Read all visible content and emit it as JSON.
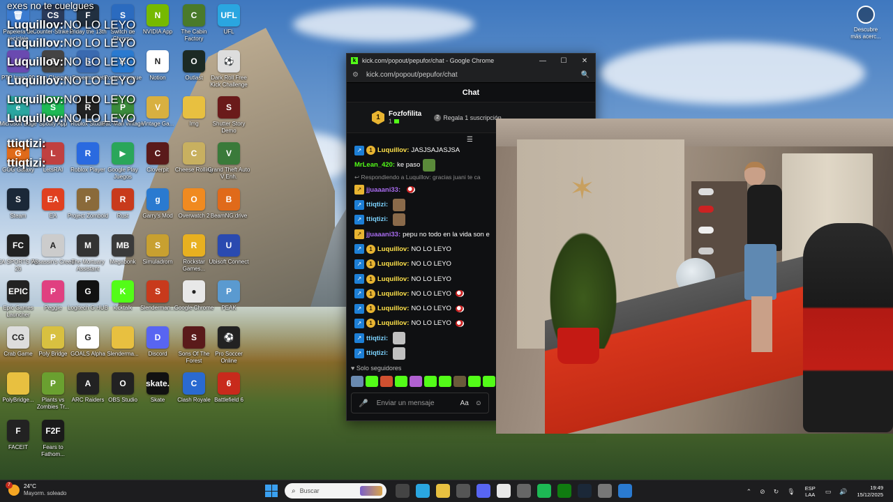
{
  "overlay": {
    "top_text": "exes no te cuelgues",
    "lines": [
      {
        "user": "Luquillov:",
        "text": "NO LO LEYO"
      },
      {
        "user": "Luquillov:",
        "text": "NO LO LEYO"
      },
      {
        "user": "Luquillov:",
        "text": "NO LO LEYO"
      },
      {
        "user": "Luquillov:",
        "text": "NO LO LEYO"
      },
      {
        "user": "Luquillov:",
        "text": "NO LO LEYO"
      },
      {
        "user": "Luquillov:",
        "text": "NO LO LEYO"
      },
      {
        "user": "ttiqtizi:",
        "text": ""
      },
      {
        "user": "ttiqtizi:",
        "text": ""
      }
    ]
  },
  "desktop_icons": [
    {
      "label": "Papelera de reciclaje",
      "color": "#3b7bd0",
      "glyph": "🗑"
    },
    {
      "label": "Counter-Strike 2",
      "color": "#2a3a5a",
      "glyph": "CS"
    },
    {
      "label": "Friday the 13th",
      "color": "#213040",
      "glyph": "F"
    },
    {
      "label": "Switch de Chrome",
      "color": "#2b6bbf",
      "glyph": "S"
    },
    {
      "label": "NVIDIA App",
      "color": "#76b900",
      "glyph": "N"
    },
    {
      "label": "The Cabin Factory",
      "color": "#4a7a2a",
      "glyph": "C"
    },
    {
      "label": "UFL",
      "color": "#2aa6e0",
      "glyph": "UFL"
    },
    {
      "label": "PTP Isaac 90",
      "color": "#6a4ab0",
      "glyph": "V"
    },
    {
      "label": "Tom Clancy's",
      "color": "#444",
      "glyph": "G"
    },
    {
      "label": "Supermarket",
      "color": "#3a6ab0",
      "glyph": "S"
    },
    {
      "label": "Rocket League",
      "color": "#2a7ad0",
      "glyph": "R"
    },
    {
      "label": "Notion",
      "color": "#fff",
      "glyph": "N"
    },
    {
      "label": "Outlast",
      "color": "#1c2a24",
      "glyph": "O"
    },
    {
      "label": "Dark Roll Free Kick Challenge",
      "color": "#ddd",
      "glyph": "⚽"
    },
    {
      "label": "Microsoft Edge",
      "color": "#2aa6a0",
      "glyph": "e"
    },
    {
      "label": "Spotify App",
      "color": "#1db954",
      "glyph": "S"
    },
    {
      "label": "Roblox Studio",
      "color": "#222",
      "glyph": "R"
    },
    {
      "label": "Pac-Man vintage",
      "color": "#3a8a3a",
      "glyph": "P"
    },
    {
      "label": "Vintage Ga...",
      "color": "#d8b040",
      "glyph": "V"
    },
    {
      "label": "Img",
      "color": "#e8c040",
      "glyph": ""
    },
    {
      "label": "Shutter Story Demo",
      "color": "#6a1a1a",
      "glyph": "S"
    },
    {
      "label": "GOG Galaxy",
      "color": "#e06a1a",
      "glyph": "G"
    },
    {
      "label": "LetsRAI",
      "color": "#c04040",
      "glyph": "L"
    },
    {
      "label": "Roblox Player",
      "color": "#2a6ae0",
      "glyph": "R"
    },
    {
      "label": "Google Play Juegos",
      "color": "#2aa65a",
      "glyph": "▶"
    },
    {
      "label": "Cloverpit",
      "color": "#5a1a1a",
      "glyph": "C"
    },
    {
      "label": "Cheese Rolling",
      "color": "#c8b060",
      "glyph": "C"
    },
    {
      "label": "Grand Theft Auto V Enh.",
      "color": "#3a7a3a",
      "glyph": "V"
    },
    {
      "label": "Steam",
      "color": "#1b2838",
      "glyph": "S"
    },
    {
      "label": "EA",
      "color": "#e04020",
      "glyph": "EA"
    },
    {
      "label": "Project Zomboid",
      "color": "#8a6a3a",
      "glyph": "P"
    },
    {
      "label": "Rust",
      "color": "#c83a1c",
      "glyph": "R"
    },
    {
      "label": "Garry's Mod",
      "color": "#2a7ad0",
      "glyph": "g"
    },
    {
      "label": "Overwatch 2",
      "color": "#f08a20",
      "glyph": "O"
    },
    {
      "label": "BeamNG.drive",
      "color": "#e06a1a",
      "glyph": "B"
    },
    {
      "label": "EA SPORTS FC 26",
      "color": "#222",
      "glyph": "FC"
    },
    {
      "label": "Assassin's Creed",
      "color": "#ccc",
      "glyph": "A"
    },
    {
      "label": "The Mortuary Assistant",
      "color": "#333",
      "glyph": "M"
    },
    {
      "label": "Megabonk",
      "color": "#3a3a3a",
      "glyph": "MB"
    },
    {
      "label": "Simuladrorn",
      "color": "#c8a030",
      "glyph": "S"
    },
    {
      "label": "Rockstar Games...",
      "color": "#e8b020",
      "glyph": "R"
    },
    {
      "label": "Ubisoft Connect",
      "color": "#2a4ab0",
      "glyph": "U"
    },
    {
      "label": "Epic Games Launcher",
      "color": "#222",
      "glyph": "EPIC"
    },
    {
      "label": "Peggle",
      "color": "#e04080",
      "glyph": "P"
    },
    {
      "label": "Logitech G HUB",
      "color": "#111",
      "glyph": "G"
    },
    {
      "label": "kicktalk",
      "color": "#53fc18",
      "glyph": "K"
    },
    {
      "label": "Slenderman...",
      "color": "#c83a1c",
      "glyph": "S"
    },
    {
      "label": "Google Chrome",
      "color": "#e8e8e8",
      "glyph": "●"
    },
    {
      "label": "PEAK",
      "color": "#5a9ad0",
      "glyph": "P"
    },
    {
      "label": "Crab Game",
      "color": "#ddd",
      "glyph": "CG"
    },
    {
      "label": "Poly Bridge",
      "color": "#d8c040",
      "glyph": "P"
    },
    {
      "label": "GOALS Alpha",
      "color": "#fff",
      "glyph": "G"
    },
    {
      "label": "Slenderma...",
      "color": "#e8c040",
      "glyph": ""
    },
    {
      "label": "Discord",
      "color": "#5865f2",
      "glyph": "D"
    },
    {
      "label": "Sons Of The Forest",
      "color": "#5a1a1a",
      "glyph": "S"
    },
    {
      "label": "Pro Soccer Online",
      "color": "#222",
      "glyph": "⚽"
    },
    {
      "label": "PolyBridge...",
      "color": "#e8c040",
      "glyph": ""
    },
    {
      "label": "Plants vs Zombies Tr...",
      "color": "#6aa030",
      "glyph": "P"
    },
    {
      "label": "ARC Raiders",
      "color": "#222",
      "glyph": "A"
    },
    {
      "label": "OBS Studio",
      "color": "#222",
      "glyph": "O"
    },
    {
      "label": "Skate",
      "color": "#111",
      "glyph": "skate."
    },
    {
      "label": "Clash Royale",
      "color": "#2a6ad0",
      "glyph": "C"
    },
    {
      "label": "Battlefield 6",
      "color": "#c82a1c",
      "glyph": "6"
    },
    {
      "label": "FACEIT",
      "color": "#222",
      "glyph": "F"
    },
    {
      "label": "Fears to Fathom...",
      "color": "#1a1a1a",
      "glyph": "F2F"
    }
  ],
  "widget": {
    "label": "Descubre más acerc..."
  },
  "chrome": {
    "title": "kick.com/popout/pepufor/chat - Google Chrome",
    "url": "kick.com/popout/pepufor/chat",
    "minimize": "—",
    "maximize": "☐",
    "close": "✕"
  },
  "chat": {
    "header": "Chat",
    "pinned": {
      "badge": "1",
      "name": "Fozfofilita",
      "sub": "1",
      "gift_count": "2",
      "gift_text": "Regala 1 suscripción"
    },
    "reply_text": "↩ Respondiendo a Luquillov: gracias juani te ca",
    "messages": [
      {
        "type": "msg",
        "badge": "blue",
        "coin": "1",
        "user": "Luquillov:",
        "user_color": "#ffe24a",
        "text": "JASJSAJASJSA",
        "emote": ""
      },
      {
        "type": "msg",
        "badge": "",
        "coin": "",
        "user": "MrLean_420:",
        "user_color": "#53fc18",
        "text": "ke paso",
        "emote": "#5a8a3a"
      },
      {
        "type": "reply"
      },
      {
        "type": "msg",
        "badge": "gold",
        "coin": "",
        "user": "jjuaaani33:",
        "user_color": "#a96cf0",
        "text": "",
        "emote": "small"
      },
      {
        "type": "msg",
        "badge": "blue",
        "coin": "",
        "user": "ttiqtizi:",
        "user_color": "#7cd3ff",
        "text": "",
        "emote": "#8a6a4a"
      },
      {
        "type": "msg",
        "badge": "blue",
        "coin": "",
        "user": "ttiqtizi:",
        "user_color": "#7cd3ff",
        "text": "",
        "emote": "#8a6a4a"
      },
      {
        "type": "msg",
        "badge": "gold",
        "coin": "",
        "user": "jjuaaani33:",
        "user_color": "#a96cf0",
        "text": "pepu no todo en la vida son e",
        "emote": ""
      },
      {
        "type": "msg",
        "badge": "blue",
        "coin": "1",
        "user": "Luquillov:",
        "user_color": "#ffe24a",
        "text": "NO LO LEYO",
        "emote": ""
      },
      {
        "type": "msg",
        "badge": "blue",
        "coin": "1",
        "user": "Luquillov:",
        "user_color": "#ffe24a",
        "text": "NO LO LEYO",
        "emote": ""
      },
      {
        "type": "msg",
        "badge": "blue",
        "coin": "1",
        "user": "Luquillov:",
        "user_color": "#ffe24a",
        "text": "NO LO LEYO",
        "emote": ""
      },
      {
        "type": "msg",
        "badge": "blue",
        "coin": "1",
        "user": "Luquillov:",
        "user_color": "#ffe24a",
        "text": "NO LO LEYO",
        "emote": "small"
      },
      {
        "type": "msg",
        "badge": "blue",
        "coin": "1",
        "user": "Luquillov:",
        "user_color": "#ffe24a",
        "text": "NO LO LEYO",
        "emote": "small"
      },
      {
        "type": "msg",
        "badge": "blue",
        "coin": "1",
        "user": "Luquillov:",
        "user_color": "#ffe24a",
        "text": "NO LO LEYO",
        "emote": "small"
      },
      {
        "type": "msg",
        "badge": "blue",
        "coin": "",
        "user": "ttiqtizi:",
        "user_color": "#7cd3ff",
        "text": "",
        "emote": "#c0c0c0"
      },
      {
        "type": "msg",
        "badge": "blue",
        "coin": "",
        "user": "ttiqtizi:",
        "user_color": "#7cd3ff",
        "text": "",
        "emote": "#c0c0c0"
      }
    ],
    "followers_only": "Solo seguidores",
    "input_placeholder": "Enviar un mensaje",
    "emote_colors": [
      "#6a8ab0",
      "#53fc18",
      "#d05030",
      "#53fc18",
      "#b060d0",
      "#53fc18",
      "#53fc18",
      "#6a5a3a",
      "#53fc18",
      "#53fc18"
    ]
  },
  "taskbar": {
    "weather_temp": "24°C",
    "weather_desc": "Mayorm. soleado",
    "weather_badge": "7",
    "search_placeholder": "Buscar",
    "apps": [
      {
        "name": "task-view-icon",
        "color": "#444"
      },
      {
        "name": "edge-icon",
        "color": "#2aa6e0"
      },
      {
        "name": "file-explorer-icon",
        "color": "#e8c040"
      },
      {
        "name": "store-icon",
        "color": "#555"
      },
      {
        "name": "discord-icon",
        "color": "#5865f2"
      },
      {
        "name": "chrome-icon",
        "color": "#e8e8e8"
      },
      {
        "name": "clock-app-icon",
        "color": "#666"
      },
      {
        "name": "spotify-icon",
        "color": "#1db954"
      },
      {
        "name": "xbox-icon",
        "color": "#107c10"
      },
      {
        "name": "steam-icon",
        "color": "#1b2838"
      },
      {
        "name": "settings-icon",
        "color": "#777"
      },
      {
        "name": "kick-app-icon",
        "color": "#2a7ad0"
      }
    ],
    "lang_top": "ESP",
    "lang_bottom": "LAA",
    "time": "19:49",
    "date": "15/12/2025"
  }
}
